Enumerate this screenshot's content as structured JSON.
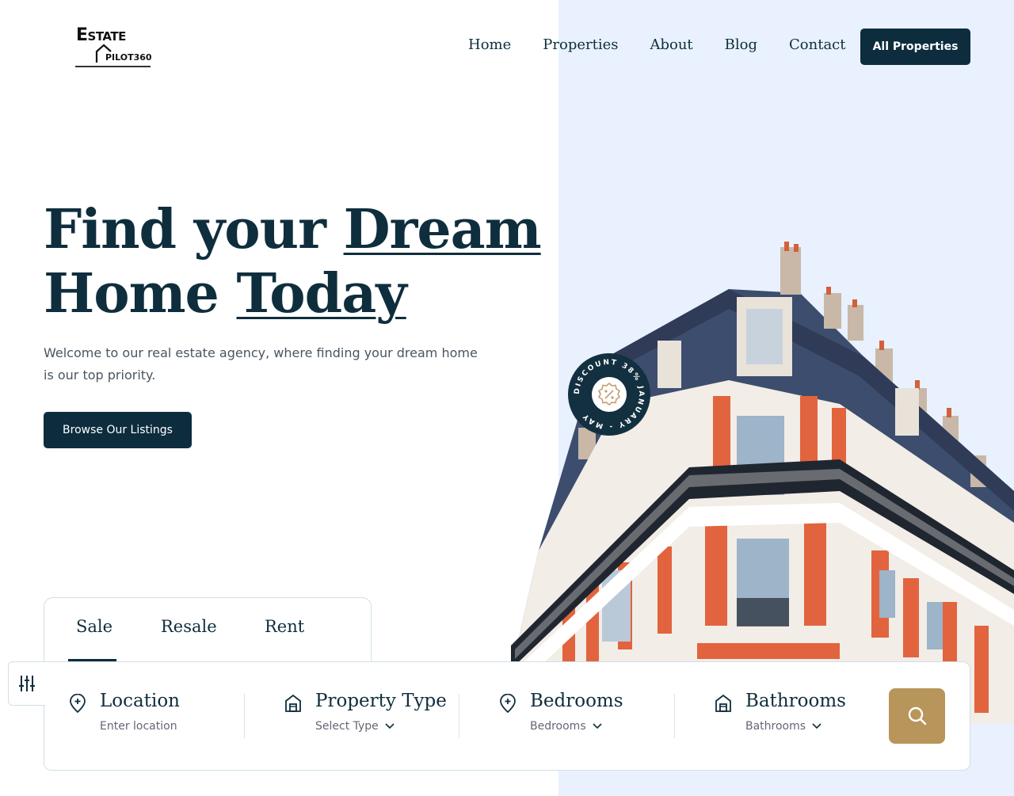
{
  "brand": {
    "line1_big": "E",
    "line1_rest": "STATE",
    "line2": "PILOT360"
  },
  "nav": {
    "items": [
      "Home",
      "Properties",
      "About",
      "Blog",
      "Contact"
    ],
    "cta": "All Properties"
  },
  "hero": {
    "title_part1": "Find your ",
    "title_highlight1": "Dream",
    "title_part2": "Home ",
    "title_highlight2": "Today",
    "subtitle": "Welcome to our real estate agency, where finding your dream home is our top priority.",
    "button": "Browse Our Listings"
  },
  "badge": {
    "text": "DISCOUNT 38% JANUARY - MAY"
  },
  "tabs": [
    "Sale",
    "Resale",
    "Rent"
  ],
  "search": {
    "fields": [
      {
        "label": "Location",
        "value": "Enter location",
        "icon": "location-pin-icon"
      },
      {
        "label": "Property Type",
        "value": "Select Type",
        "icon": "house-icon"
      },
      {
        "label": "Bedrooms",
        "value": "Bedrooms",
        "icon": "location-pin-icon"
      },
      {
        "label": "Bathrooms",
        "value": "Bathrooms",
        "icon": "house-icon"
      }
    ],
    "button_icon": "search-icon"
  },
  "colors": {
    "primary": "#0d2d3e",
    "accent": "#b8955b",
    "panel": "#e8f1fd"
  }
}
